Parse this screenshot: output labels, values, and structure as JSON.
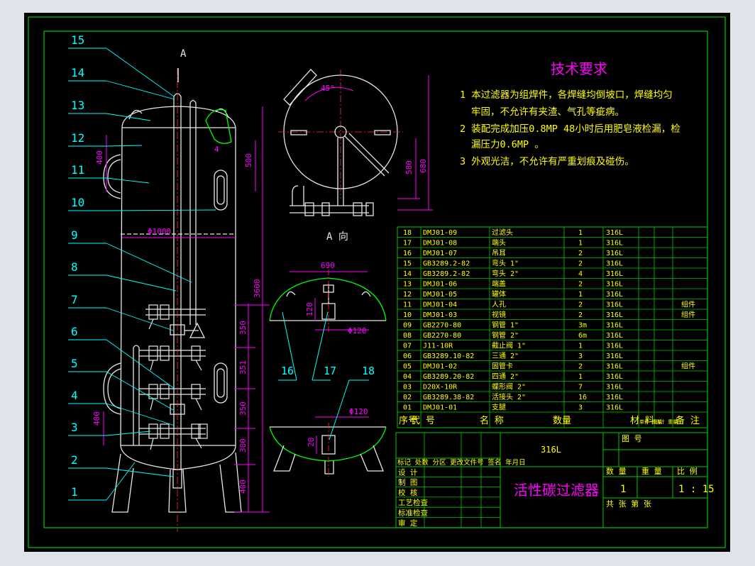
{
  "section_label": "A",
  "view_caption": "A  向",
  "balloons": [
    "15",
    "14",
    "13",
    "12",
    "11",
    "10",
    "9",
    "8",
    "7",
    "6",
    "5",
    "4",
    "3",
    "2",
    "1"
  ],
  "lower_balloons": [
    "16",
    "17",
    "18"
  ],
  "dimensions": {
    "d400_upper": "400",
    "d500": "500",
    "d1000": "Φ1000",
    "d3600": "3600",
    "d350_a": "350",
    "d351": "351",
    "d350_b": "350",
    "d300": "300",
    "d400_lower": "400",
    "d400_left": "400",
    "d4": "4",
    "angle45": "45°",
    "d580": "580",
    "d680": "680",
    "d690": "690",
    "d120_v": "120",
    "d120_phi": "Φ120",
    "d120_phi2": "Φ120",
    "d20": "20"
  },
  "tech": {
    "title": "技术要求",
    "l1a": "1 本过滤器为组焊件，各焊缝均倒坡口，焊缝均匀",
    "l1b": "牢固，不允许有夹渣、气孔等疵病。",
    "l2a": "2 装配完成加压0.8MP 48小时后用肥皂液检漏，检",
    "l2b": "漏压力0.6MP 。",
    "l3": "3 外观光洁，不允许有严重划痕及碰伤。"
  },
  "bom": [
    {
      "no": "18",
      "code": "DMJ01-09",
      "name": "过滤头",
      "qty": "1",
      "mat": "316L",
      "note": ""
    },
    {
      "no": "17",
      "code": "DMJ01-08",
      "name": "端头",
      "qty": "1",
      "mat": "316L",
      "note": ""
    },
    {
      "no": "16",
      "code": "DMJ01-07",
      "name": "吊耳",
      "qty": "2",
      "mat": "316L",
      "note": ""
    },
    {
      "no": "15",
      "code": "GB3289.2-82",
      "name": "弯头   1\"",
      "qty": "2",
      "mat": "316L",
      "note": ""
    },
    {
      "no": "14",
      "code": "GB3289.2-82",
      "name": "弯头   2\"",
      "qty": "4",
      "mat": "316L",
      "note": ""
    },
    {
      "no": "13",
      "code": "DMJ01-06",
      "name": "端盖",
      "qty": "2",
      "mat": "316L",
      "note": ""
    },
    {
      "no": "12",
      "code": "DMJ01-05",
      "name": "罐体",
      "qty": "1",
      "mat": "316L",
      "note": ""
    },
    {
      "no": "11",
      "code": "DMJ01-04",
      "name": "人孔",
      "qty": "2",
      "mat": "316L",
      "note": "组件"
    },
    {
      "no": "10",
      "code": "DMJ01-03",
      "name": "视镜",
      "qty": "2",
      "mat": "316L",
      "note": "组件"
    },
    {
      "no": "09",
      "code": "GB2270-80",
      "name": "钢管   1\"",
      "qty": "3m",
      "mat": "316L",
      "note": ""
    },
    {
      "no": "08",
      "code": "GB2270-80",
      "name": "钢管   2\"",
      "qty": "6m",
      "mat": "316L",
      "note": ""
    },
    {
      "no": "07",
      "code": "J11-10R",
      "name": "截止阀  1\"",
      "qty": "1",
      "mat": "316L",
      "note": ""
    },
    {
      "no": "06",
      "code": "GB3289.10-82",
      "name": "三通   2\"",
      "qty": "3",
      "mat": "316L",
      "note": ""
    },
    {
      "no": "05",
      "code": "DMJ01-02",
      "name": "固管卡",
      "qty": "2",
      "mat": "316L",
      "note": "组件"
    },
    {
      "no": "04",
      "code": "GB3289.20-82",
      "name": "四通   2\"",
      "qty": "1",
      "mat": "316L",
      "note": ""
    },
    {
      "no": "03",
      "code": "D20X-10R",
      "name": "蝶形阀  2\"",
      "qty": "7",
      "mat": "316L",
      "note": ""
    },
    {
      "no": "02",
      "code": "GB3289.38-82",
      "name": "活接头  2\"",
      "qty": "16",
      "mat": "316L",
      "note": ""
    },
    {
      "no": "01",
      "code": "DMJ01-01",
      "name": "支腿",
      "qty": "3",
      "mat": "316L",
      "note": ""
    }
  ],
  "bom_header": {
    "seq": "序号",
    "code": "代  号",
    "name": "名  称",
    "qty": "数量",
    "mat": "材  料",
    "unit_weight": "单件 重量",
    "total_weight": "总计 重量",
    "note": "备  注"
  },
  "title_block": {
    "material": "316L",
    "drawing_name": "活性碳过滤器",
    "fig_no_label": "图  号",
    "qty_label": "数  量",
    "weight_label": "重  量",
    "scale_label": "比  例",
    "qty": "1",
    "scale": "1 : 15",
    "sheets": "共      张  第      张",
    "rev_row": "标记 处数  分区  更改文件号  签名  年月日",
    "rows": [
      "设  计",
      "制  图",
      "校  核",
      "工艺检查",
      "标准检查",
      "审  定"
    ]
  },
  "colors": {
    "background": "#000000",
    "outer_bg": "#dfe4ea",
    "frame": "#00c800",
    "vessel": "#e8e8e8",
    "dimension": "#ff00ff",
    "balloon": "#00ffff",
    "text": "#ffff00",
    "title": "#ff00ff",
    "table_line": "#00c800"
  }
}
